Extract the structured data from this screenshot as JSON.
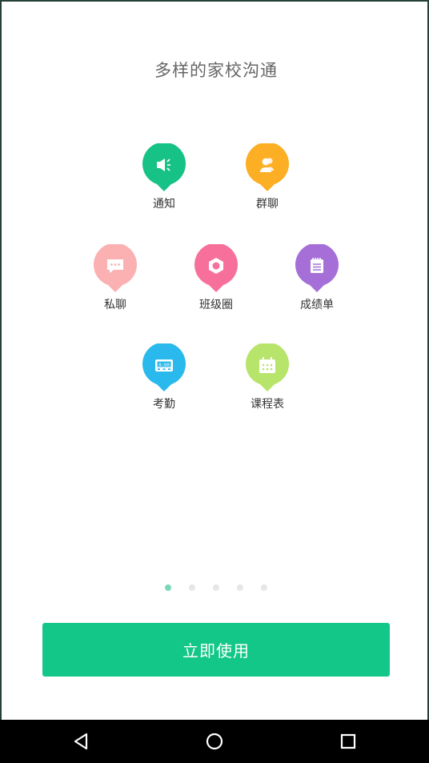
{
  "header": {
    "title": "多样的家校沟通"
  },
  "features": {
    "notice": {
      "label": "通知",
      "icon": "speaker-icon",
      "color": "#17c287"
    },
    "group_chat": {
      "label": "群聊",
      "icon": "people-icon",
      "color": "#fcae24"
    },
    "private_chat": {
      "label": "私聊",
      "icon": "chat-bubble-icon",
      "color": "#fbb0b2"
    },
    "class_circle": {
      "label": "班级圈",
      "icon": "hexagon-icon",
      "color": "#f7709c"
    },
    "report_card": {
      "label": "成绩单",
      "icon": "notepad-icon",
      "color": "#a56fd7"
    },
    "attendance": {
      "label": "考勤",
      "icon": "time-clock-icon",
      "color": "#2ab9ec"
    },
    "timetable": {
      "label": "课程表",
      "icon": "calendar-icon",
      "color": "#b7e46a"
    }
  },
  "attendance_clock_text": "8:00",
  "pager": {
    "count": 5,
    "active_index": 0,
    "active_color": "#7ad8b9",
    "inactive_color": "#e6e6e6"
  },
  "cta": {
    "label": "立即使用",
    "color": "#12c787"
  },
  "system_nav": {
    "back": "back-triangle-icon",
    "home": "home-circle-icon",
    "recents": "recents-square-icon"
  }
}
